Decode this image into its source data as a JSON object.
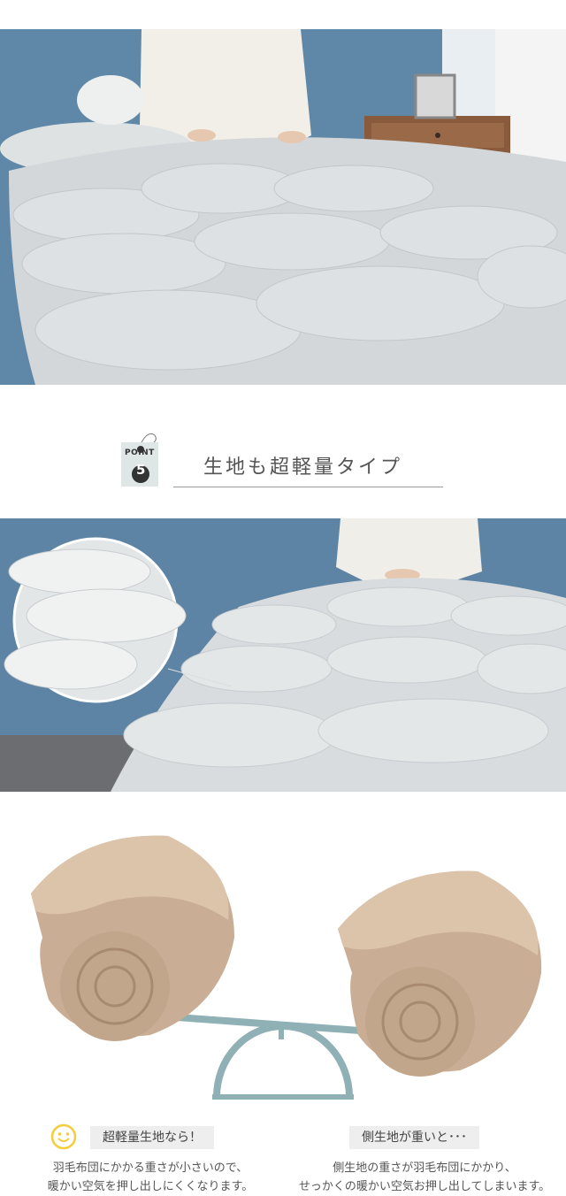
{
  "point": {
    "word": "POINT",
    "number": "5"
  },
  "heading": "生地も超軽量タイプ",
  "labels": {
    "left": "超軽量生地なら！",
    "right": "側生地が重いと･･･"
  },
  "descriptions": {
    "left_line1": "羽毛布団にかかる重さが小さいので、",
    "left_line2": "暖かい空気を押し出しにくくなります。",
    "right_line1": "側生地の重さが羽毛布団にかかり、",
    "right_line2": "せっかくの暖かい空気お押し出してしまいます。"
  },
  "colors": {
    "wall": "#5e86a6",
    "duvet": "#d9dde0",
    "rolled_duvet": "#cfb59c",
    "seesaw": "#8fb0b5",
    "smiley": "#f2cf3a"
  }
}
